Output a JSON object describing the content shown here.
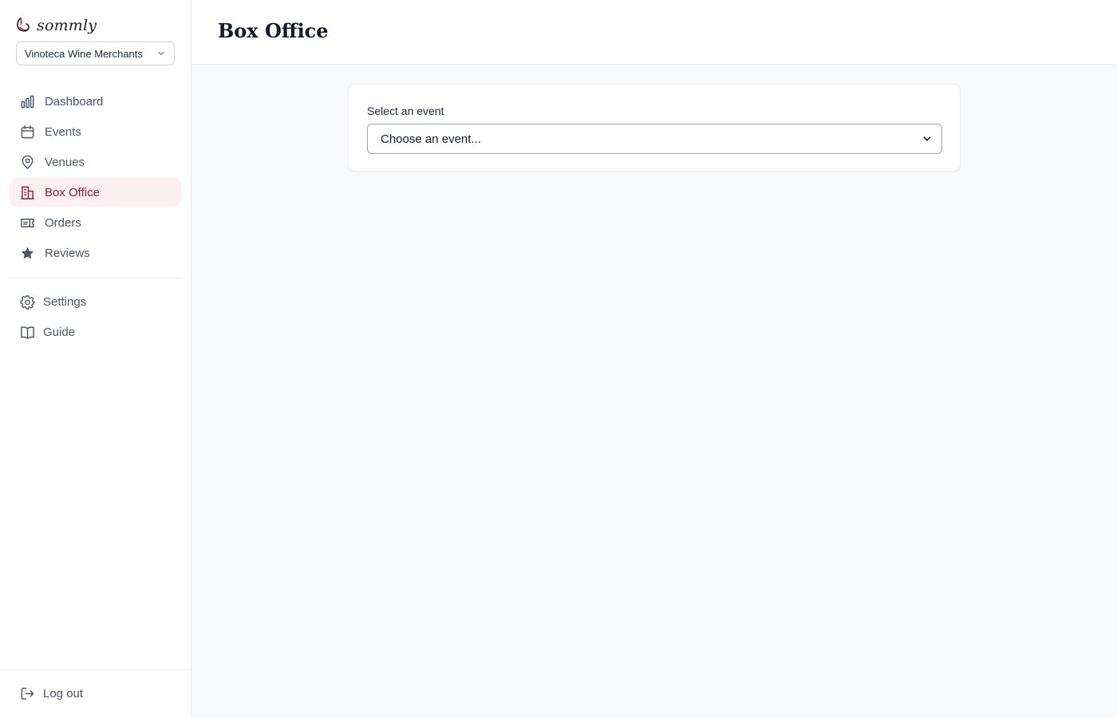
{
  "brand": {
    "name": "sommly",
    "accent": "#8b1e3f"
  },
  "org_switcher": {
    "value": "Vinoteca Wine Merchants"
  },
  "nav": [
    {
      "id": "dashboard",
      "label": "Dashboard",
      "icon": "bar-chart-icon"
    },
    {
      "id": "events",
      "label": "Events",
      "icon": "calendar-icon"
    },
    {
      "id": "venues",
      "label": "Venues",
      "icon": "map-pin-icon"
    },
    {
      "id": "box-office",
      "label": "Box Office",
      "icon": "building-icon",
      "active": true
    },
    {
      "id": "orders",
      "label": "Orders",
      "icon": "ticket-icon"
    },
    {
      "id": "reviews",
      "label": "Reviews",
      "icon": "star-icon"
    }
  ],
  "secondary_nav": [
    {
      "id": "settings",
      "label": "Settings",
      "icon": "gear-icon"
    },
    {
      "id": "guide",
      "label": "Guide",
      "icon": "book-icon"
    }
  ],
  "logout": {
    "label": "Log out",
    "icon": "log-out-icon"
  },
  "page": {
    "title": "Box Office",
    "event_select": {
      "label": "Select an event",
      "value": "Choose an event..."
    }
  }
}
